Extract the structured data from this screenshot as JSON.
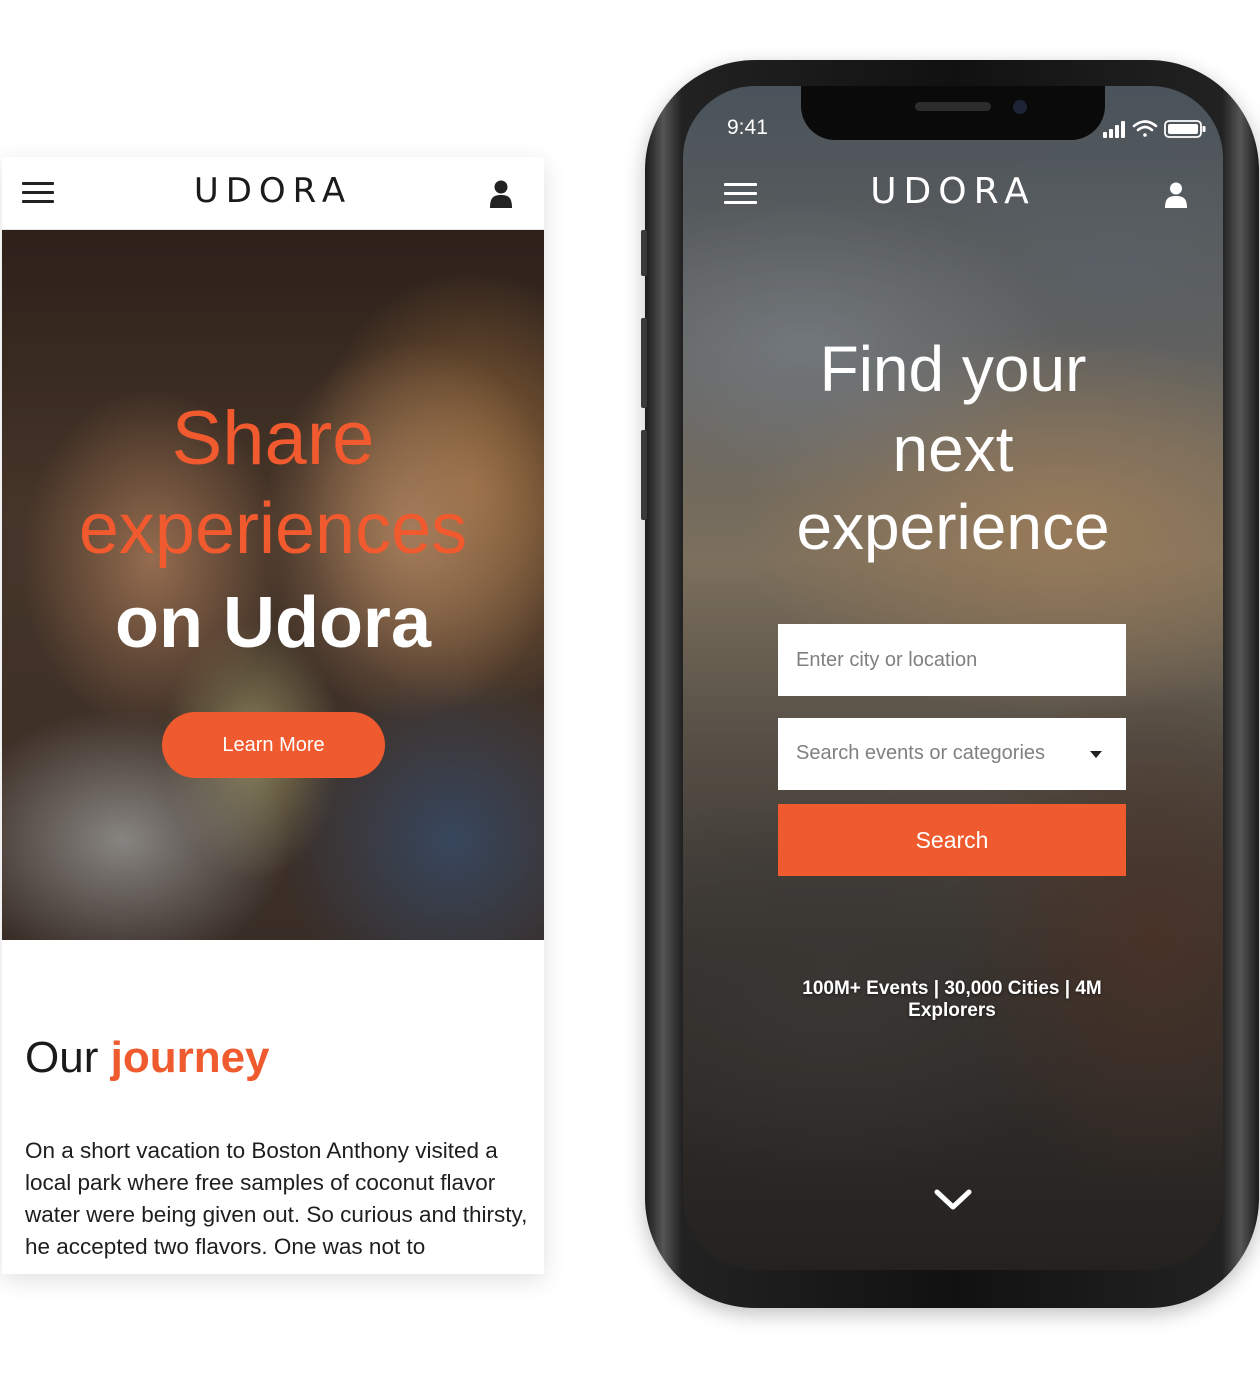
{
  "left_page": {
    "logo": "UDORA",
    "hero": {
      "line1": "Share",
      "line2": "experiences",
      "line3": "on Udora",
      "cta_label": "Learn More"
    },
    "journey": {
      "title_plain": "Our",
      "title_accent": "journey",
      "body": "On a short vacation to Boston Anthony visited a local park where free samples of coconut flavor water were being given out. So curious and thirsty, he accepted two flavors. One was not to"
    }
  },
  "right_phone": {
    "status_bar": {
      "time": "9:41"
    },
    "logo": "UDORA",
    "headline": {
      "line1": "Find your",
      "line2": "next",
      "line3": "experience"
    },
    "search": {
      "city_placeholder": "Enter city or location",
      "category_placeholder": "Search events or categories",
      "button_label": "Search"
    },
    "stats_text": "100M+ Events | 30,000 Cities | 4M Explorers"
  },
  "colors": {
    "accent": "#ef5a2e",
    "text_dark": "#1a1a1a",
    "white": "#ffffff"
  },
  "icons": {
    "menu": "hamburger-menu-icon",
    "user": "user-icon",
    "dropdown": "caret-down-icon",
    "scroll": "chevron-down-icon",
    "signal": "signal-bars-icon",
    "wifi": "wifi-icon",
    "battery": "battery-icon"
  }
}
